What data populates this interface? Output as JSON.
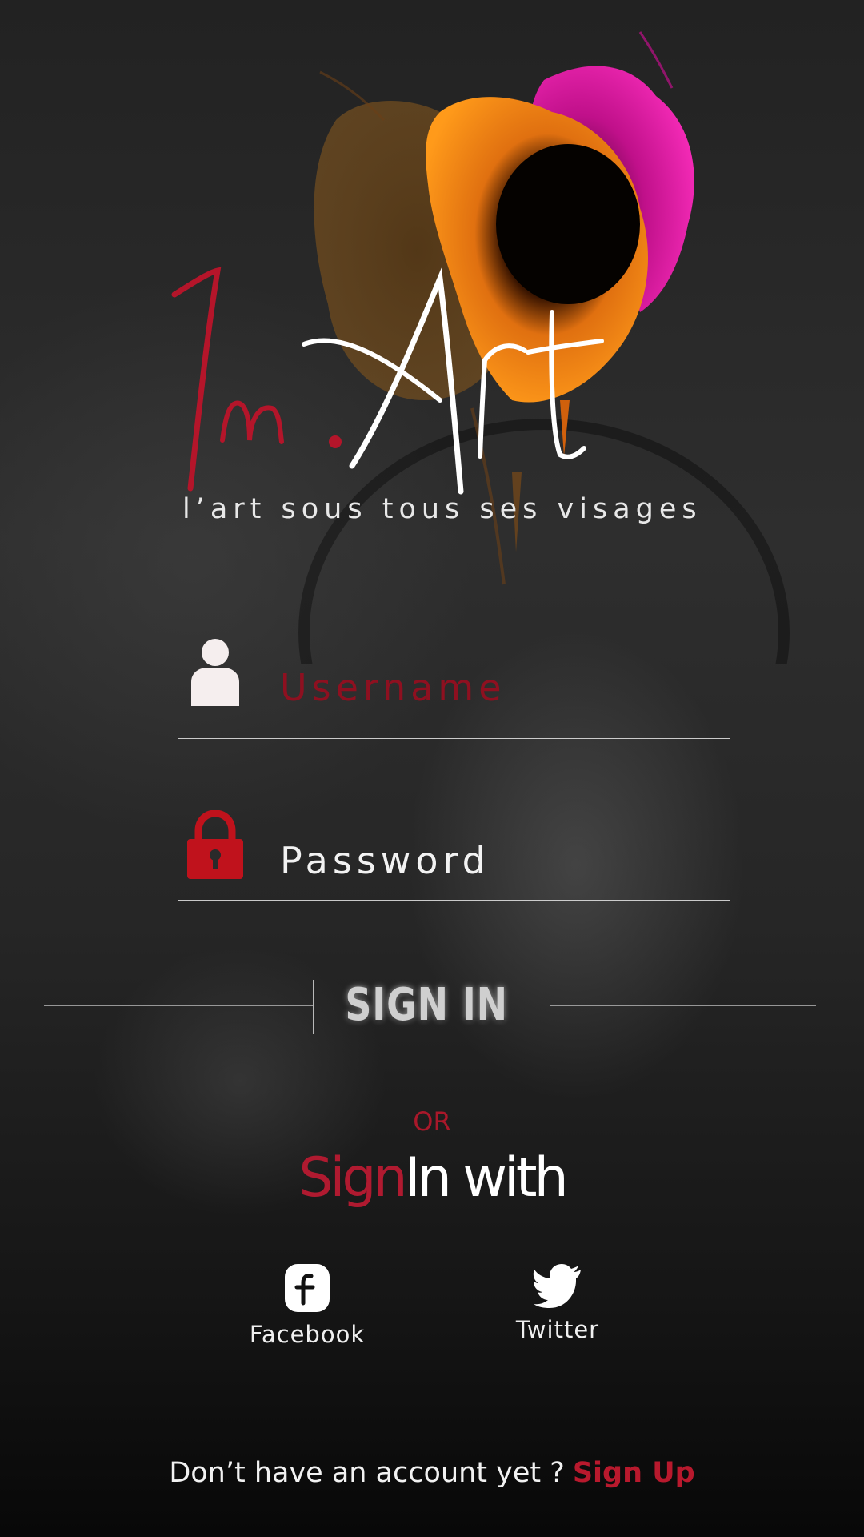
{
  "brand": {
    "logo_prefix": "In.",
    "logo_main": "Art",
    "tagline": "l’art sous tous ses visages"
  },
  "form": {
    "username_placeholder": "Username",
    "password_placeholder": "Password",
    "signin_label": "SIGN IN"
  },
  "alt_login": {
    "or_label": "OR",
    "signin_with_red": "Sign",
    "signin_with_white": "In with",
    "facebook_label": "Facebook",
    "twitter_label": "Twitter"
  },
  "footer": {
    "prompt": "Don’t have an account yet ?",
    "signup_label": "Sign Up"
  },
  "icons": {
    "username": "user-icon",
    "password": "lock-icon",
    "facebook": "facebook-icon",
    "twitter": "twitter-icon"
  },
  "colors": {
    "accent_red": "#b01a30",
    "text_white": "#ffffff",
    "user_icon": "#f5eeee",
    "lock_icon": "#c0121c"
  }
}
